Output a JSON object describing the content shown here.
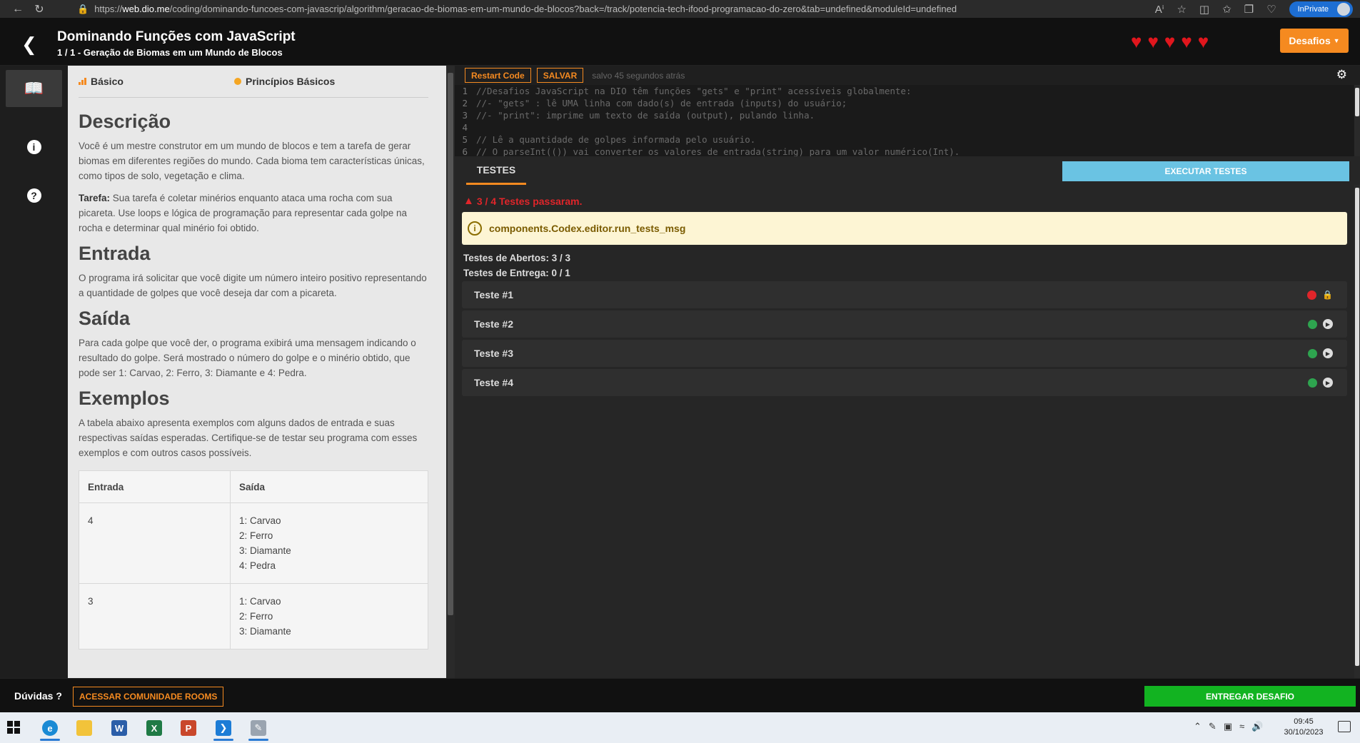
{
  "browser": {
    "url_prefix": "https://",
    "url_domain": "web.dio.me",
    "url_path": "/coding/dominando-funcoes-com-javascrip/algorithm/geracao-de-biomas-em-um-mundo-de-blocos?back=/track/potencia-tech-ifood-programacao-do-zero&tab=undefined&moduleId=undefined",
    "inprivate_label": "InPrivate"
  },
  "header": {
    "title": "Dominando Funções com JavaScript",
    "subtitle": "1 / 1 - Geração de Biomas em um Mundo de Blocos",
    "lives": 5,
    "desafios_label": "Desafios"
  },
  "description": {
    "tags": {
      "level": "Básico",
      "topic": "Princípios Básicos"
    },
    "sections": {
      "descricao_title": "Descrição",
      "descricao_text": "Você é um mestre construtor em um mundo de blocos e tem a tarefa de gerar biomas em diferentes regiões do mundo. Cada bioma tem características únicas, como tipos de solo, vegetação e clima.",
      "tarefa_label": "Tarefa:",
      "tarefa_text": " Sua tarefa é coletar minérios enquanto ataca uma rocha com sua picareta. Use loops e lógica de programação para representar cada golpe na rocha e determinar qual minério foi obtido.",
      "entrada_title": "Entrada",
      "entrada_text": "O programa irá solicitar que você digite um número inteiro positivo representando a quantidade de golpes que você deseja dar com a picareta.",
      "saida_title": "Saída",
      "saida_text": "Para cada golpe que você der, o programa exibirá uma mensagem indicando o resultado do golpe. Será mostrado o número do golpe e o minério obtido, que pode ser 1: Carvao, 2: Ferro, 3: Diamante e 4: Pedra.",
      "exemplos_title": "Exemplos",
      "exemplos_text": "A tabela abaixo apresenta exemplos com alguns dados de entrada e suas respectivas saídas esperadas. Certifique-se de testar seu programa com esses exemplos e com outros casos possíveis."
    },
    "table": {
      "headers": [
        "Entrada",
        "Saída"
      ],
      "rows": [
        {
          "input": "4",
          "output": [
            "1: Carvao",
            "2: Ferro",
            "3: Diamante",
            "4: Pedra"
          ]
        },
        {
          "input": "3",
          "output": [
            "1: Carvao",
            "2: Ferro",
            "3: Diamante"
          ]
        }
      ]
    }
  },
  "editor": {
    "restart_label": "Restart Code",
    "save_label": "SALVAR",
    "saved_text": "salvo 45 segundos atrás",
    "lines": [
      "//Desafios JavaScript na DIO têm funções \"gets\" e \"print\" acessíveis globalmente:",
      "//- \"gets\" : lê UMA linha com dado(s) de entrada (inputs) do usuário;",
      "//- \"print\": imprime um texto de saída (output), pulando linha.",
      "",
      "// Lê a quantidade de golpes informada pelo usuário.",
      "// O parseInt(()) vai converter os valores de entrada(string) para um valor numérico(Int)."
    ]
  },
  "tests": {
    "tab_label": "TESTES",
    "run_label": "EXECUTAR TESTES",
    "passed_text": "3 / 4 Testes passaram.",
    "alert_text": "components.Codex.editor.run_tests_msg",
    "open_tests": "Testes de Abertos: 3 / 3",
    "delivery_tests": "Testes de Entrega: 0 / 1",
    "items": [
      {
        "label": "Teste #1",
        "status": "failed",
        "locked": true
      },
      {
        "label": "Teste #2",
        "status": "passed",
        "locked": false
      },
      {
        "label": "Teste #3",
        "status": "passed",
        "locked": false
      },
      {
        "label": "Teste #4",
        "status": "passed",
        "locked": false
      }
    ]
  },
  "footer": {
    "duvidas_label": "Dúvidas ?",
    "community_label": "ACESSAR COMUNIDADE ROOMS",
    "submit_label": "ENTREGAR DESAFIO"
  },
  "taskbar": {
    "time": "09:45",
    "date": "30/10/2023",
    "apps": [
      "edge-icon",
      "file-explorer-icon",
      "word-icon",
      "excel-icon",
      "powerpoint-icon",
      "vscode-icon",
      "tool-icon"
    ]
  },
  "colors": {
    "accent": "#f58a20",
    "success": "#12b321",
    "error": "#e0252a",
    "run": "#6ac3e3"
  }
}
